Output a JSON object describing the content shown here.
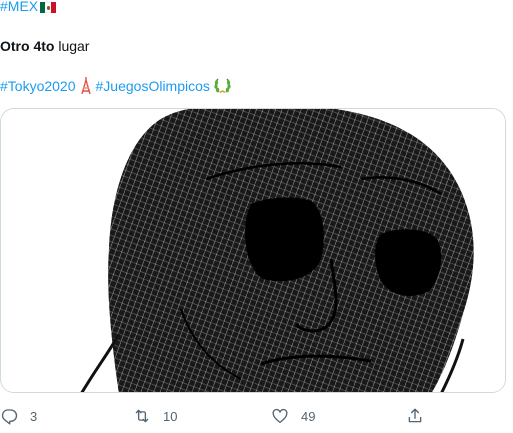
{
  "tweet": {
    "hashtag_mex": "#MEX",
    "text_bold": "Otro 4to",
    "text_rest": " lugar",
    "hashtag_tokyo": "#Tokyo2020",
    "hashtag_juegos": "#JuegosOlimpicos",
    "flag_icon": "mexico-flag-icon",
    "tower_icon": "tokyo-tower-icon",
    "laurel_icon": "laurel-wreath-icon"
  },
  "media": {
    "image_icon": "wojak-face-sketch-image"
  },
  "actions": {
    "reply_count": "3",
    "retweet_count": "10",
    "like_count": "49",
    "icon_color": "#536471"
  },
  "colors": {
    "hashtag": "#1d9bf0",
    "text": "#0f1419",
    "border": "#cfd9de"
  }
}
